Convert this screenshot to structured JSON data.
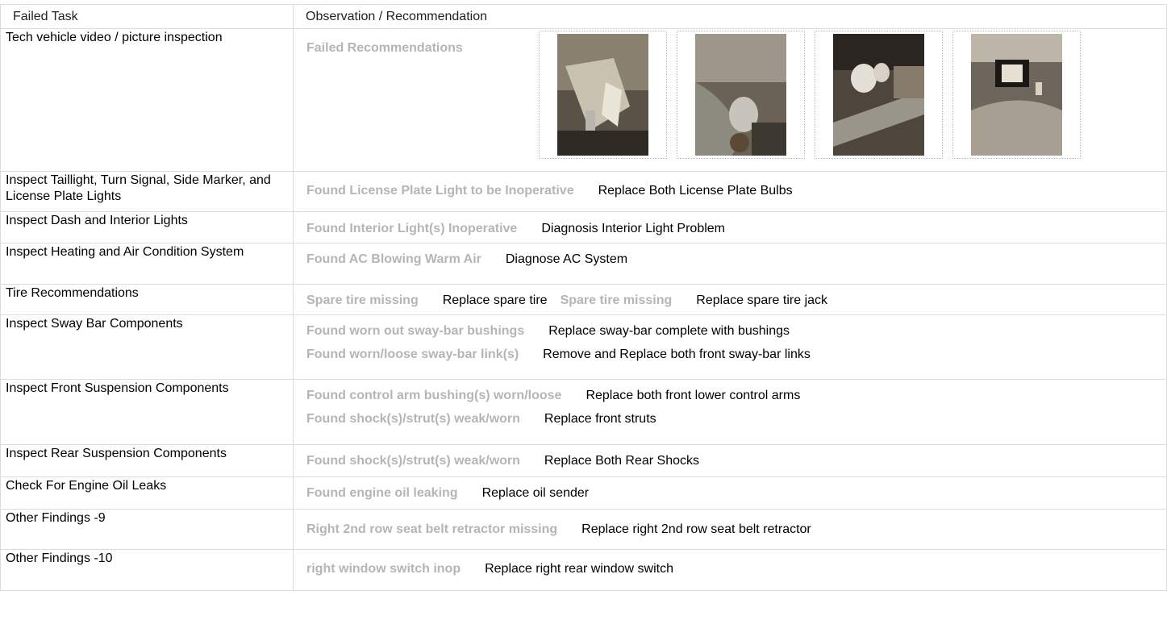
{
  "header": {
    "col_task": "Failed Task",
    "col_obs": "Observation / Recommendation"
  },
  "row0": {
    "task": "Tech vehicle video / picture inspection",
    "finding": "Failed Recommendations",
    "photos": [
      "photo-1",
      "photo-2",
      "photo-3",
      "photo-4"
    ]
  },
  "rows": [
    {
      "task": "Inspect Taillight, Turn Signal, Side Marker, and License Plate Lights",
      "items": [
        {
          "finding": "Found License Plate Light to be Inoperative",
          "rec": "Replace Both License Plate Bulbs"
        }
      ]
    },
    {
      "task": "Inspect Dash and Interior Lights",
      "items": [
        {
          "finding": "Found Interior Light(s) Inoperative",
          "rec": "Diagnosis Interior Light Problem"
        }
      ]
    },
    {
      "task": "Inspect Heating and Air Condition System",
      "items": [
        {
          "finding": "Found AC Blowing Warm Air",
          "rec": "Diagnose AC System"
        }
      ]
    },
    {
      "task": "Tire Recommendations",
      "items": [
        {
          "finding": "Spare tire missing",
          "rec": "Replace spare tire"
        },
        {
          "finding": "Spare tire missing",
          "rec": "Replace spare tire jack"
        }
      ]
    },
    {
      "task": "Inspect Sway Bar Components",
      "items": [
        {
          "finding": "Found worn out sway-bar bushings",
          "rec": "Replace sway-bar complete with bushings"
        },
        {
          "finding": "Found worn/loose sway-bar link(s)",
          "rec": "Remove and Replace both front sway-bar links"
        }
      ]
    },
    {
      "task": "Inspect Front Suspension Components",
      "items": [
        {
          "finding": "Found control arm bushing(s) worn/loose",
          "rec": "Replace both front lower control arms"
        },
        {
          "finding": "Found shock(s)/strut(s) weak/worn",
          "rec": "Replace front struts"
        }
      ]
    },
    {
      "task": "Inspect Rear Suspension Components",
      "items": [
        {
          "finding": "Found shock(s)/strut(s) weak/worn",
          "rec": "Replace Both Rear Shocks"
        }
      ]
    },
    {
      "task": "Check For Engine Oil Leaks",
      "items": [
        {
          "finding": "Found engine oil leaking",
          "rec": "Replace oil sender"
        }
      ]
    },
    {
      "task": "Other Findings -9",
      "items": [
        {
          "finding": "Right 2nd row seat belt retractor missing",
          "rec": "Replace right 2nd row seat belt retractor"
        }
      ]
    },
    {
      "task": "Other Findings -10",
      "items": [
        {
          "finding": "right window switch inop",
          "rec": "Replace right rear window switch"
        }
      ]
    }
  ]
}
